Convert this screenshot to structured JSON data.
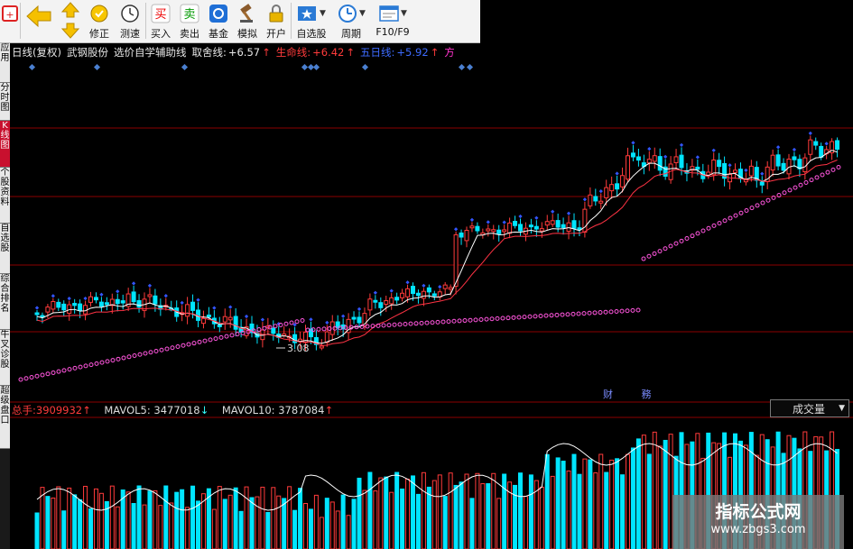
{
  "toolbar": {
    "items": [
      {
        "label": "",
        "icon": "back-icon"
      },
      {
        "label": "修正",
        "icon": "fix-icon"
      },
      {
        "label": "测速",
        "icon": "speed-test-icon"
      },
      {
        "label": "买入",
        "icon": "buy-icon",
        "glyph": "买"
      },
      {
        "label": "卖出",
        "icon": "sell-icon",
        "glyph": "卖"
      },
      {
        "label": "基金",
        "icon": "fund-icon"
      },
      {
        "label": "模拟",
        "icon": "simulate-icon"
      },
      {
        "label": "开户",
        "icon": "open-account-icon"
      },
      {
        "label": "自选股",
        "icon": "watchlist-icon"
      },
      {
        "label": "周期",
        "icon": "period-icon"
      },
      {
        "label": "F10/F9",
        "icon": "f10-icon"
      }
    ]
  },
  "side_tabs": [
    "应用",
    "分时图",
    "K线图",
    "个股资料",
    "自选股",
    "综合排名",
    "牛叉诊股",
    "超级盘口"
  ],
  "active_side_tab": 2,
  "info": {
    "period": "日线(复权)",
    "stock": "武钢股份",
    "formula": "选价自学辅助线",
    "line1_label": "取舍线:",
    "line1_value": "+6.57",
    "line2_label": "生命线:",
    "line2_value": "+6.42",
    "line3_label": "五日线:",
    "line3_value": "+5.92",
    "line4_label": "方"
  },
  "annotation": "3.08",
  "caiwu": "财 務",
  "volume": {
    "total_label": "总手:",
    "total_value": "3909932",
    "mavol5_label": "MAVOL5:",
    "mavol5_value": "3477018",
    "mavol10_label": "MAVOL10:",
    "mavol10_value": "3787084",
    "selector": "成交量"
  },
  "watermark": {
    "title": "指标公式网",
    "url": "www.zbgs3.com"
  },
  "colors": {
    "up": "#ff3b3b",
    "down": "#00e5ff",
    "ma_fast": "#ffffff",
    "ma_slow": "#ff3344",
    "support": "#ff55dd",
    "grid": "#8b0000"
  }
}
